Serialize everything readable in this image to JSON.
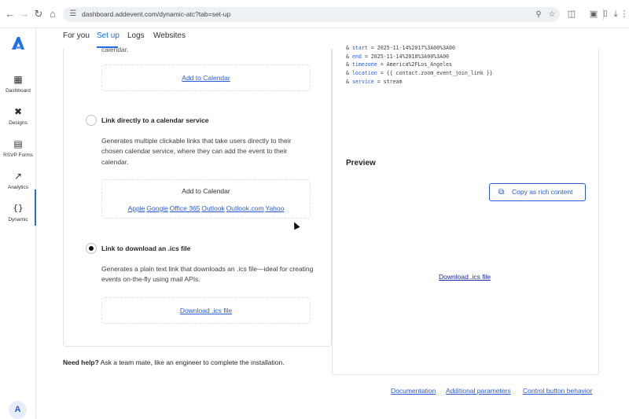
{
  "browser": {
    "url": "dashboard.addevent.com/dynamic-atc?tab=set-up"
  },
  "sidebar": {
    "items": [
      {
        "label": "Dashboard",
        "icon": "calendar-icon"
      },
      {
        "label": "Designs",
        "icon": "tools-icon"
      },
      {
        "label": "RSVP Forms",
        "icon": "form-icon"
      },
      {
        "label": "Analytics",
        "icon": "trend-icon"
      },
      {
        "label": "Dynamic",
        "icon": "braces-icon"
      }
    ],
    "avatar_initial": "A"
  },
  "tabs": [
    {
      "label": "For you"
    },
    {
      "label": "Set up"
    },
    {
      "label": "Logs"
    },
    {
      "label": "Websites"
    }
  ],
  "options": {
    "partial_text": "calendar.",
    "first_link": "Add to Calendar",
    "link_directly": {
      "title": "Link directly to a calendar service",
      "description": "Generates multiple clickable links that take users directly to their chosen calendar service, where they can add the event to their calendar.",
      "preview_title": "Add to Calendar",
      "services": [
        "Apple",
        "Google",
        "Office 365",
        "Outlook",
        "Outlook.com",
        "Yahoo"
      ]
    },
    "ics": {
      "title": "Link to download an .ics file",
      "description": "Generates a plain text link that downloads an .ics file—ideal for creating events on-the-fly using mail APIs.",
      "link": "Download .ics file"
    }
  },
  "code": {
    "lines": [
      {
        "prefix": "& ",
        "key": "start",
        "value": " = 2025-11-14%2017%3A00%3A00"
      },
      {
        "prefix": "& ",
        "key": "end",
        "value": " = 2025-11-14%2018%3A00%3A00"
      },
      {
        "prefix": "& ",
        "key": "timezone",
        "value": " = America%2FLos_Angeles"
      },
      {
        "prefix": "& ",
        "key": "location",
        "value": " = {{ contact.zoom_event_join_link }}"
      },
      {
        "prefix": "& ",
        "key": "service",
        "value": " = stream"
      }
    ]
  },
  "preview": {
    "heading": "Preview",
    "copy_button": "Copy as rich content",
    "download_link": "Download .ics file"
  },
  "help": {
    "bold": "Need help?",
    "text": " Ask a team mate, like an engineer to complete the installation."
  },
  "footer_links": [
    "Documentation",
    "Additional parameters",
    "Control button behavior"
  ]
}
